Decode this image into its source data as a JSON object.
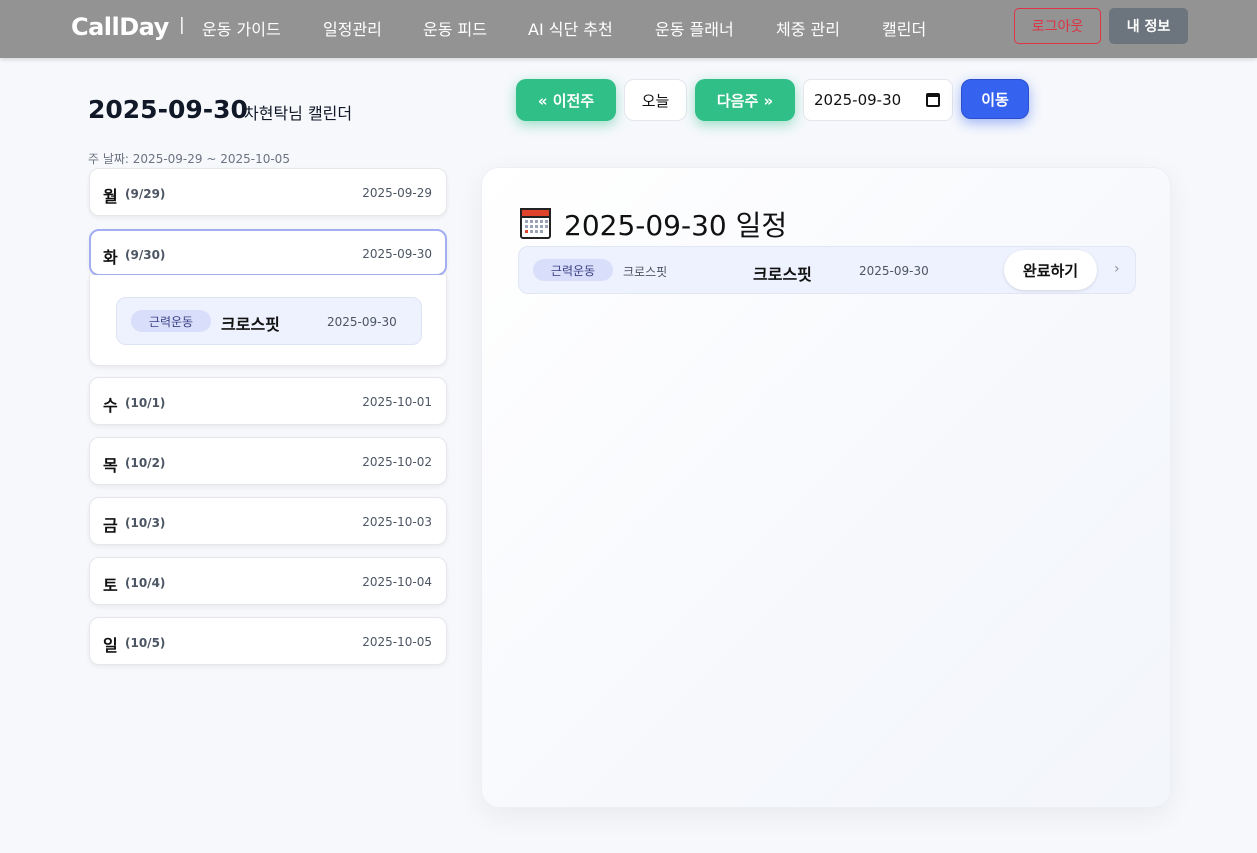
{
  "nav": {
    "brand": "CallDay",
    "separator": "|",
    "links": [
      "운동 가이드",
      "일정관리",
      "운동 피드",
      "AI 식단 추천",
      "운동 플래너",
      "체중 관리",
      "캘린더"
    ],
    "logout": "로그아웃",
    "myinfo": "내 정보"
  },
  "header": {
    "date": "2025-09-30",
    "subtitle": "차현탁님 캘린더",
    "week_range": "주 날짜: 2025-09-29 ~ 2025-10-05"
  },
  "controls": {
    "prev_week": "« 이전주",
    "today": "오늘",
    "next_week": "다음주 »",
    "date_value": "2025-09-30",
    "go": "이동"
  },
  "days": [
    {
      "name": "월",
      "md": "(9/29)",
      "date": "2025-09-29"
    },
    {
      "name": "화",
      "md": "(9/30)",
      "date": "2025-09-30"
    },
    {
      "name": "수",
      "md": "(10/1)",
      "date": "2025-10-01"
    },
    {
      "name": "목",
      "md": "(10/2)",
      "date": "2025-10-02"
    },
    {
      "name": "금",
      "md": "(10/3)",
      "date": "2025-10-03"
    },
    {
      "name": "토",
      "md": "(10/4)",
      "date": "2025-10-04"
    },
    {
      "name": "일",
      "md": "(10/5)",
      "date": "2025-10-05"
    }
  ],
  "selected_day_event": {
    "category": "근력운동",
    "title": "크로스핏",
    "date": "2025-09-30"
  },
  "panel": {
    "title": "2025-09-30 일정",
    "icon": "calendar-icon",
    "event": {
      "category": "근력운동",
      "subtitle": "크로스핏",
      "title": "크로스핏",
      "date": "2025-09-30",
      "complete": "완료하기",
      "chevron": "›"
    }
  },
  "colors": {
    "nav_bg": "#939393",
    "green": "#2fbf87",
    "blue": "#3563f0",
    "danger": "#dc3545",
    "badge_bg": "#d9defa",
    "event_bg": "#eef2fe"
  }
}
